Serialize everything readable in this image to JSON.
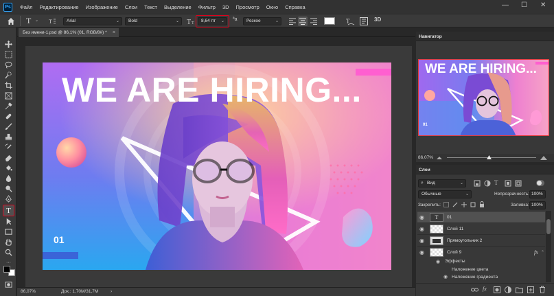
{
  "app": {
    "logo": "Ps",
    "menu": [
      "Файл",
      "Редактирование",
      "Изображение",
      "Слои",
      "Текст",
      "Выделение",
      "Фильтр",
      "3D",
      "Просмотр",
      "Окно",
      "Справка"
    ],
    "window_controls": {
      "minimize": "—",
      "maximize": "☐",
      "close": "✕"
    }
  },
  "options": {
    "font_family": "Arial",
    "font_style": "Bold",
    "font_size": "8,64 пт",
    "antialias": "Резкое",
    "mode_3d": "3D",
    "highlight_color": "#e0001b"
  },
  "document": {
    "tab_title": "Без имени-1.psd @ 86,1% (01, RGB/8#) *",
    "close": "×"
  },
  "poster": {
    "headline": "WE ARE HIRING...",
    "number": "01"
  },
  "status": {
    "zoom": "86,07%",
    "doc_size": "Док.: 1,70M/31,7M",
    "arrow": "›"
  },
  "navigator": {
    "title": "Навигатор",
    "zoom": "86,07%",
    "headline": "WE ARE HIRING...",
    "number": "01"
  },
  "layers": {
    "title": "Слои",
    "filter_kind": "Вид",
    "blend_mode": "Обычные",
    "opacity_label": "Непрозрачность:",
    "opacity_value": "100%",
    "lock_label": "Закрепить:",
    "fill_label": "Заливка:",
    "fill_value": "100%",
    "items": [
      {
        "name": "01",
        "type": "text"
      },
      {
        "name": "Слой 11",
        "type": "pixel"
      },
      {
        "name": "Прямоугольник 2",
        "type": "shape"
      },
      {
        "name": "Слой 9",
        "type": "pixel",
        "fx": "fx"
      }
    ],
    "effects_label": "Эффекты",
    "effects": [
      "Наложение цвета",
      "Наложение градиента"
    ]
  }
}
